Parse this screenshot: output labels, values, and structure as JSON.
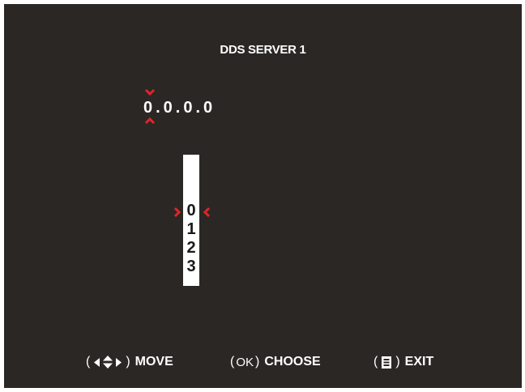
{
  "dialog": {
    "title": "DDS SERVER 1",
    "ip_address": "0.0.0.0"
  },
  "picker": {
    "options": [
      "0",
      "1",
      "2",
      "3"
    ],
    "selected": "0"
  },
  "footer": {
    "move": {
      "open": "(",
      "close": ")",
      "label": "MOVE"
    },
    "choose": {
      "open": "(",
      "key": "OK",
      "close": ")",
      "label": "CHOOSE"
    },
    "exit": {
      "open": "(",
      "close": ")",
      "label": "EXIT"
    }
  },
  "colors": {
    "background": "#2b2724",
    "text": "#ffffff",
    "accent": "#e0252b",
    "picker_background": "#ffffff",
    "picker_text": "#1a1a1a"
  },
  "icons": {
    "digit_up": "chevron-down-icon",
    "digit_down": "chevron-up-icon",
    "selection_left": "chevron-right-icon",
    "selection_right": "chevron-left-icon",
    "move_keys": "arrow-keys-icon",
    "exit_key": "menu-icon"
  }
}
